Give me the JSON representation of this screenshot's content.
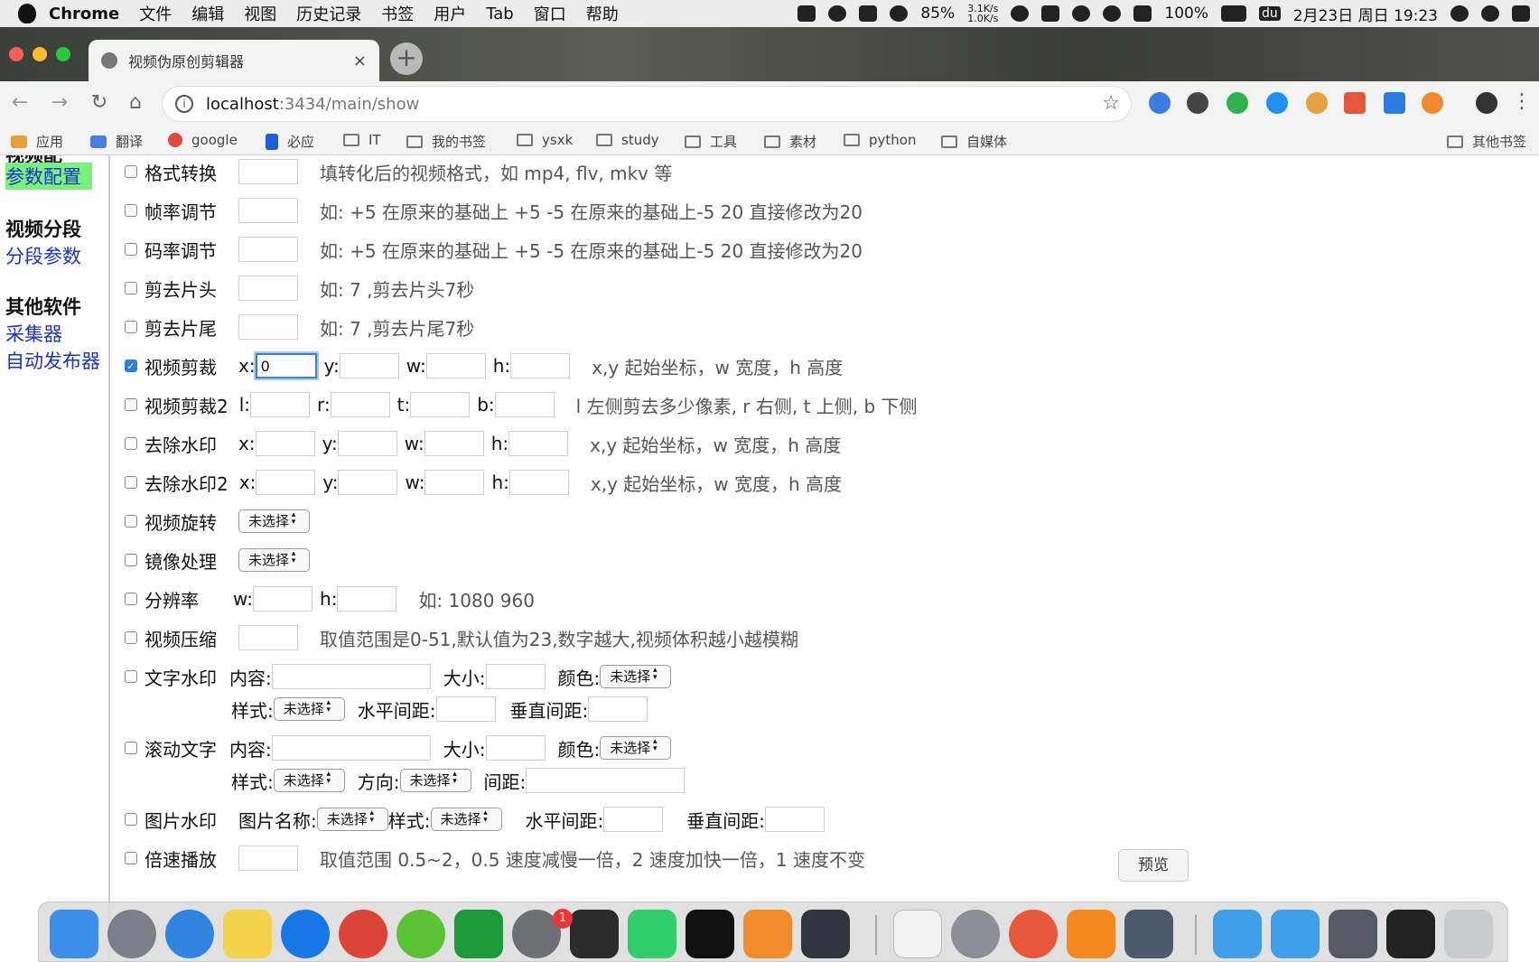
{
  "menubar": {
    "app": "Chrome",
    "items": [
      "文件",
      "编辑",
      "视图",
      "历史记录",
      "书签",
      "用户",
      "Tab",
      "窗口",
      "帮助"
    ],
    "battery_cpu": "85%",
    "net_up": "3.1K/s",
    "net_down": "1.0K/s",
    "battery": "100%",
    "du_badge": "du",
    "clock": "2月23日 周日 19:23"
  },
  "browser": {
    "tab_title": "视频伪原创剪辑器",
    "tab_close": "×",
    "new_tab": "+",
    "url_host": "localhost",
    "url_path": ":3434/main/show",
    "bookmarks": [
      "应用",
      "翻译",
      "google",
      "必应",
      "IT",
      "我的书签",
      "ysxk",
      "study",
      "工具",
      "素材",
      "python",
      "自媒体"
    ],
    "other_bookmarks": "其他书签"
  },
  "sidebar": {
    "cut_heading": "视频配",
    "active_link": "参数配置",
    "sections": [
      {
        "heading": "视频分段",
        "links": [
          "分段参数"
        ]
      },
      {
        "heading": "其他软件",
        "links": [
          "采集器",
          "自动发布器"
        ]
      }
    ]
  },
  "form": {
    "format_convert": {
      "label": "格式转换",
      "hint": "填转化后的视频格式，如 mp4, flv, mkv 等"
    },
    "fps": {
      "label": "帧率调节",
      "hint": "如: +5 在原来的基础上 +5 -5 在原来的基础上-5 20 直接修改为20"
    },
    "bitrate": {
      "label": "码率调节",
      "hint": "如: +5 在原来的基础上 +5 -5 在原来的基础上-5 20 直接修改为20"
    },
    "cut_head": {
      "label": "剪去片头",
      "hint": "如: 7 ,剪去片头7秒"
    },
    "cut_tail": {
      "label": "剪去片尾",
      "hint": "如: 7 ,剪去片尾7秒"
    },
    "crop": {
      "label": "视频剪裁",
      "x_label": "x:",
      "x_value": "0",
      "y_label": "y:",
      "w_label": "w:",
      "h_label": "h:",
      "hint": "x,y 起始坐标，w 宽度，h 高度"
    },
    "crop2": {
      "label": "视频剪裁2",
      "l_label": "l:",
      "r_label": "r:",
      "t_label": "t:",
      "b_label": "b:",
      "hint": "l 左侧剪去多少像素, r 右侧, t 上侧, b 下侧"
    },
    "remove_wm": {
      "label": "去除水印",
      "x_label": "x:",
      "y_label": "y:",
      "w_label": "w:",
      "h_label": "h:",
      "hint": "x,y 起始坐标，w 宽度，h 高度"
    },
    "remove_wm2": {
      "label": "去除水印2",
      "x_label": "x:",
      "y_label": "y:",
      "w_label": "w:",
      "h_label": "h:",
      "hint": "x,y 起始坐标，w 宽度，h 高度"
    },
    "rotate": {
      "label": "视频旋转",
      "select": "未选择"
    },
    "mirror": {
      "label": "镜像处理",
      "select": "未选择"
    },
    "resolution": {
      "label": "分辨率",
      "w_label": "w:",
      "h_label": "h:",
      "hint": "如: 1080 960"
    },
    "compress": {
      "label": "视频压缩",
      "hint": "取值范围是0-51,默认值为23,数字越大,视频体积越小越模糊"
    },
    "text_wm": {
      "label": "文字水印",
      "content_label": "内容:",
      "size_label": "大小:",
      "color_label": "颜色:",
      "color_select": "未选择",
      "style_label": "样式:",
      "style_select": "未选择",
      "hspace_label": "水平间距:",
      "vspace_label": "垂直间距:"
    },
    "scroll_text": {
      "label": "滚动文字",
      "content_label": "内容:",
      "size_label": "大小:",
      "color_label": "颜色:",
      "color_select": "未选择",
      "style_label": "样式:",
      "style_select": "未选择",
      "direction_label": "方向:",
      "direction_select": "未选择",
      "spacing_label": "间距:"
    },
    "image_wm": {
      "label": "图片水印",
      "name_label": "图片名称:",
      "name_select": "未选择",
      "style_label": "样式:",
      "style_select": "未选择",
      "hspace_label": "水平间距:",
      "vspace_label": "垂直间距:"
    },
    "speed": {
      "label": "倍速播放",
      "hint": "取值范围 0.5~2，0.5 速度减慢一倍，2 速度加快一倍，1 速度不变"
    }
  },
  "dock": {
    "tooltip": "预览",
    "badge": "1"
  },
  "colors": {
    "link": "#1a33cc",
    "active_bg": "#7cf07c",
    "focus": "#3a7ce0",
    "checkbox_checked": "#2f7de1"
  }
}
